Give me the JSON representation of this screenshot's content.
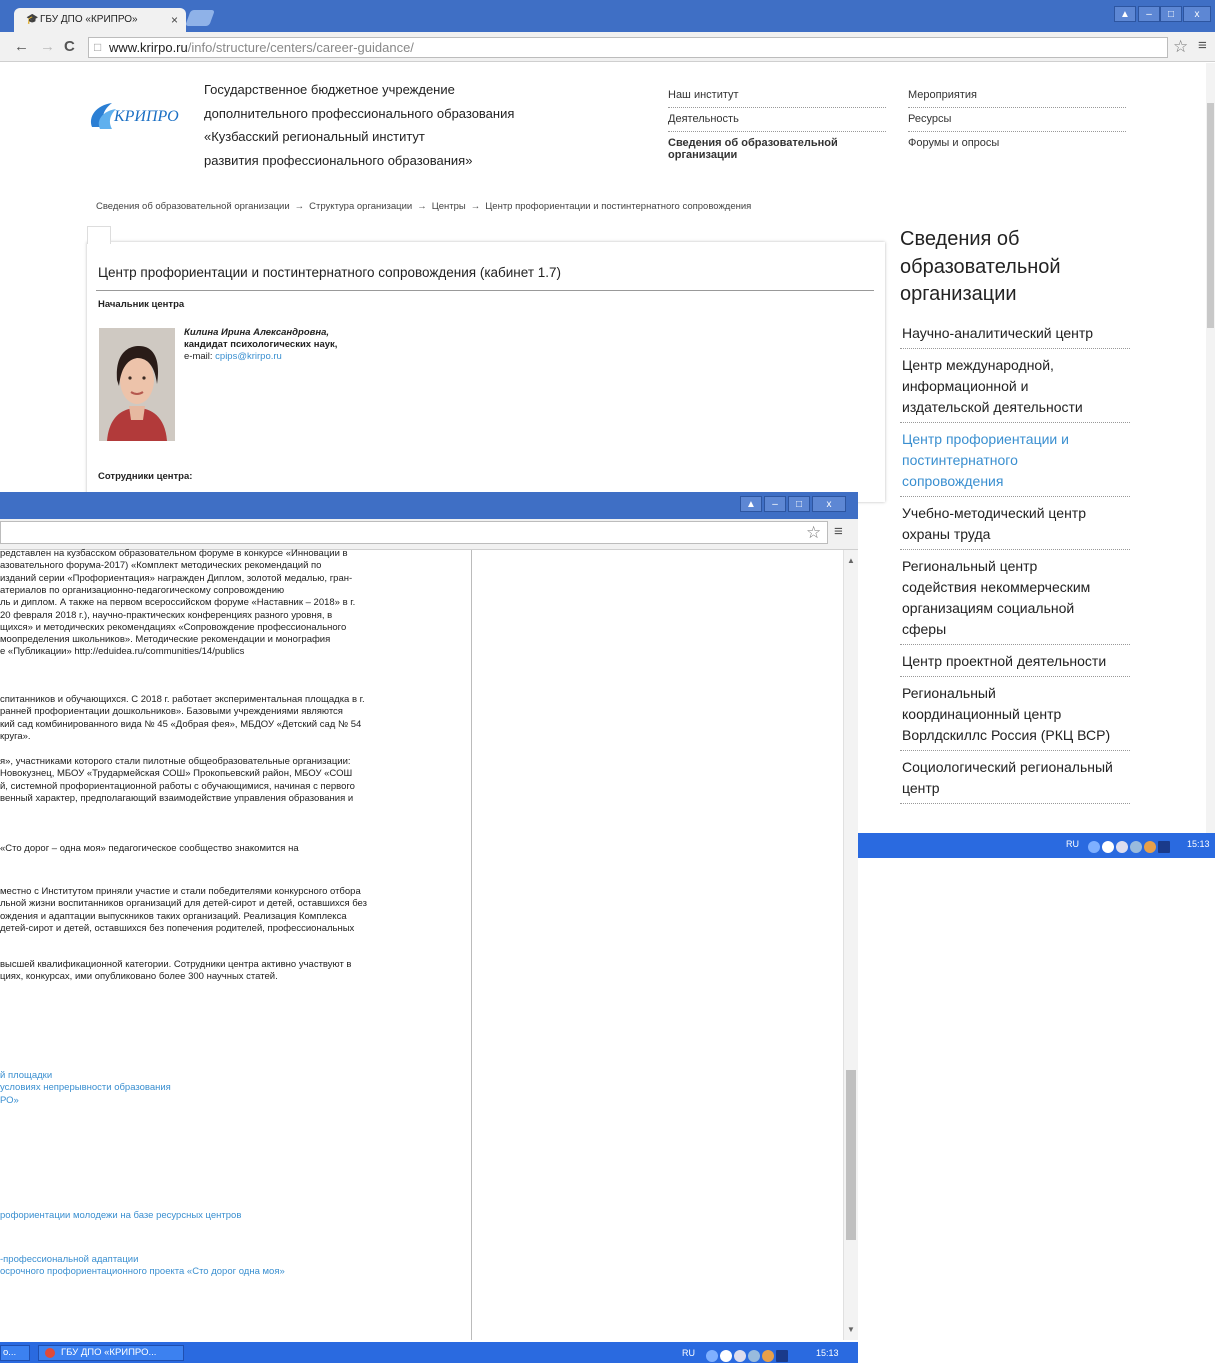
{
  "window1": {
    "tab_title": "ГБУ ДПО «КРИПРО»",
    "url": {
      "host": "www.krirpo.ru",
      "path": "/info/structure/centers/career-guidance/"
    }
  },
  "header": {
    "logo_text": "КРИПРО",
    "org_title_lines": [
      "Государственное бюджетное учреждение",
      "дополнительного профессионального образования",
      "«Кузбасский региональный институт",
      "развития профессионального образования»"
    ],
    "nav_col1": [
      "Наш институт",
      "Деятельность",
      "Сведения об образовательной",
      "организации"
    ],
    "nav_col2": [
      "Мероприятия",
      "Ресурсы",
      "Форумы и опросы"
    ]
  },
  "breadcrumb": [
    "Сведения об образовательной организации",
    "Структура организации",
    "Центры",
    "Центр профориентации и постинтернатного сопровождения"
  ],
  "content": {
    "title": "Центр профориентации и постинтернатного сопровождения (кабинет 1.7)",
    "head_label": "Начальник центра",
    "person_name": "Килина Ирина Александровна,",
    "person_degree": "кандидат психологических наук,",
    "email_label": "e-mail:",
    "email": "cpips@krirpo.ru",
    "staff_label": "Сотрудники центра:"
  },
  "sidebar": {
    "title_lines": [
      "Сведения об",
      "образовательной",
      "организации"
    ],
    "items": [
      {
        "lines": [
          "Научно-аналитический центр"
        ]
      },
      {
        "lines": [
          "Центр международной,",
          "информационной и",
          "издательской деятельности"
        ]
      },
      {
        "lines": [
          "Центр профориентации и",
          "постинтернатного",
          "сопровождения"
        ]
      },
      {
        "lines": [
          "Учебно-методический центр",
          "охраны труда"
        ]
      },
      {
        "lines": [
          "Региональный центр",
          "содействия некоммерческим",
          "организациям социальной",
          "сферы"
        ]
      },
      {
        "lines": [
          "Центр проектной деятельности"
        ]
      },
      {
        "lines": [
          "Региональный",
          "координационный центр",
          "Ворлдскиллс Россия (РКЦ ВСР)"
        ]
      },
      {
        "lines": [
          "Социологический региональный",
          "центр"
        ]
      }
    ],
    "active_index": 2
  },
  "taskbar": {
    "lang": "RU",
    "time": "15:13",
    "task_button": "ГБУ ДПО «КРИПРО...",
    "start_partial": "о..."
  },
  "window2": {
    "paragraphs": [
      [
        "редставлен на кузбасском  образовательном форуме в конкурсе «Инновации в",
        "азовательного форума-2017)  «Комплект методических рекомендаций по",
        "изданий серии «Профориентация»  награжден Диплом, золотой медалью, гран-",
        "атериалов по организационно-педагогическому сопровождению",
        "ль и диплом. А также на первом всероссийском форуме «Наставник – 2018» в г.",
        "20 февраля 2018 г.),  научно-практических конференциях разного уровня, в",
        "щихся» и методических рекомендациях «Сопровождение профессионального",
        "моопределения школьников». Методические рекомендации и монография",
        "е «Публикации» http://eduidea.ru/communities/14/publics"
      ],
      [
        "спитанников и обучающихся. С 2018 г. работает экспериментальная площадка в г.",
        "ранней профориентации дошкольников». Базовыми учреждениями являются",
        "кий сад комбинированного вида № 45 «Добрая фея», МБДОУ «Детский сад № 54",
        "круга»."
      ],
      [
        "я», участниками которого стали пилотные общеобразовательные организации:",
        "Новокузнец, МБОУ «Трудармейская СОШ» Прокопьевский район, МБОУ «СОШ",
        "й, системной профориентационной работы с обучающимися, начиная с первого",
        "венный характер, предполагающий взаимодействие управления образования и"
      ],
      [
        "«Сто дорог – одна моя» педагогическое сообщество знакомится на"
      ],
      [
        "местно с Институтом приняли участие и стали победителями конкурсного отбора",
        "льной жизни воспитанников организаций для детей-сирот и детей, оставшихся без",
        "ождения  и адаптации выпускников таких организаций. Реализация Комплекса",
        "детей-сирот и детей, оставшихся без попечения родителей, профессиональных"
      ],
      [
        "высшей квалификационной категории. Сотрудники центра активно участвуют в",
        "циях, конкурсах, ими опубликовано более 300 научных статей."
      ]
    ],
    "links_group1": [
      "й площадки",
      "условиях непрерывности образования",
      "РО»"
    ],
    "links_group2": [
      "рофориентации молодежи на базе ресурсных центров"
    ],
    "links_group3": [
      "-профессиональной адаптации",
      "осрочного профориентационного проекта «Сто дорог одна моя»"
    ]
  }
}
